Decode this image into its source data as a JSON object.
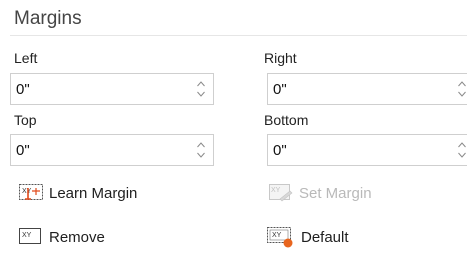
{
  "panel": {
    "title": "Margins"
  },
  "fields": {
    "left": {
      "label": "Left",
      "value": "0\""
    },
    "right": {
      "label": "Right",
      "value": "0\""
    },
    "top": {
      "label": "Top",
      "value": "0\""
    },
    "bottom": {
      "label": "Bottom",
      "value": "0\""
    }
  },
  "buttons": {
    "learn_margin": {
      "label": "Learn Margin",
      "icon": "learn-margin-icon",
      "enabled": true
    },
    "set_margin": {
      "label": "Set Margin",
      "icon": "set-margin-icon",
      "enabled": false
    },
    "remove": {
      "label": "Remove",
      "icon": "remove-margin-icon",
      "enabled": true
    },
    "default": {
      "label": "Default",
      "icon": "default-margin-icon",
      "enabled": true
    }
  },
  "colors": {
    "accent_red": "#e04a1c",
    "accent_orange": "#e8651e",
    "disabled_text": "#b9b9b9"
  }
}
